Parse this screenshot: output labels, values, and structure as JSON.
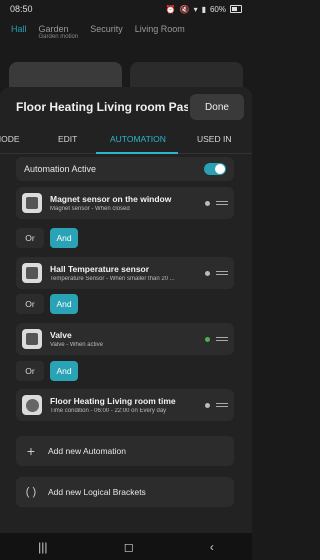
{
  "status": {
    "time": "08:50",
    "battery": "60%"
  },
  "background": {
    "tabs": [
      {
        "label": "Hall",
        "sub": ""
      },
      {
        "label": "Garden",
        "sub": "Garden motion"
      },
      {
        "label": "Security",
        "sub": ""
      },
      {
        "label": "Living Room",
        "sub": ""
      }
    ]
  },
  "sheet": {
    "title": "Floor Heating Living room Passiv...",
    "done_label": "Done",
    "tabs": [
      "MODE",
      "EDIT",
      "AUTOMATION",
      "USED IN"
    ],
    "active_tab": "AUTOMATION",
    "automation_active_label": "Automation Active",
    "automation_active": true
  },
  "automations": [
    {
      "title": "Magnet sensor on the window",
      "subtitle": "Magnet sensor - When closed",
      "dot_color": "#bbbbbb",
      "icon": "magnet-sensor-icon"
    },
    {
      "title": "Hall Temperature sensor",
      "subtitle": "Temperature Sensor - When smaller than 20 ...",
      "dot_color": "#bbbbbb",
      "icon": "temperature-sensor-icon"
    },
    {
      "title": "Valve",
      "subtitle": "Valve - When active",
      "dot_color": "#4caf50",
      "icon": "valve-icon"
    },
    {
      "title": "Floor Heating Living room time",
      "subtitle": "Time condition - 06:00 - 22:00 on Every day",
      "dot_color": "#bbbbbb",
      "icon": "clock-icon"
    }
  ],
  "connectors": [
    {
      "or": "Or",
      "and": "And",
      "selected": "And"
    },
    {
      "or": "Or",
      "and": "And",
      "selected": "And"
    },
    {
      "or": "Or",
      "and": "And",
      "selected": "And"
    }
  ],
  "actions": {
    "add_automation": "Add new Automation",
    "add_brackets": "Add new Logical Brackets"
  },
  "colors": {
    "accent": "#2cb6cc",
    "and_button": "#2ba3b6",
    "active_dot": "#4caf50"
  }
}
